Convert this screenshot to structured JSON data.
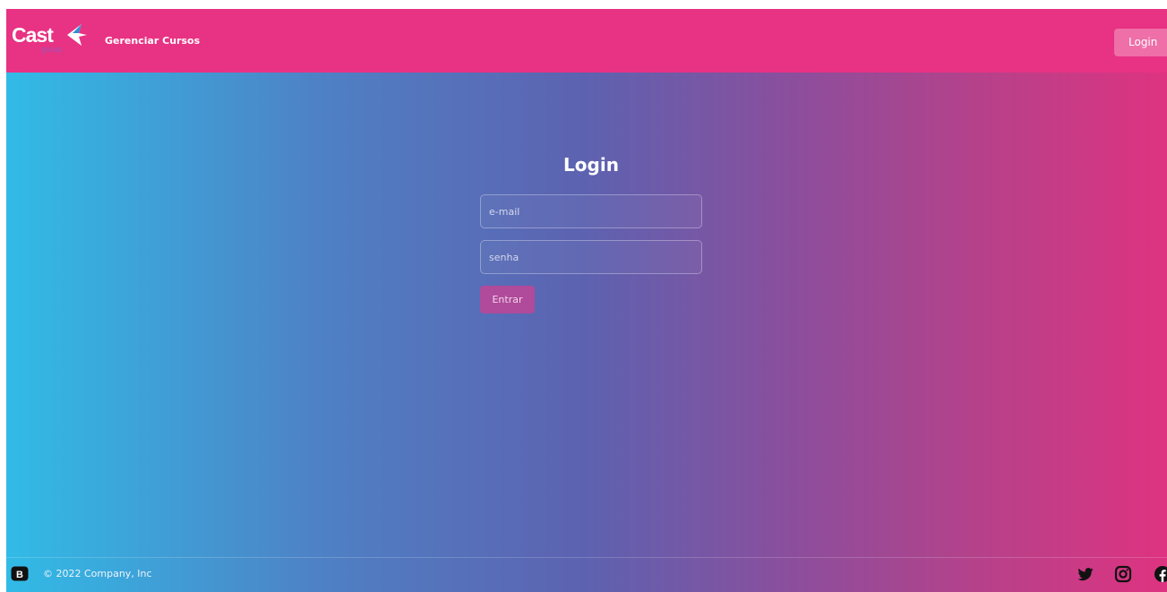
{
  "navbar": {
    "brand_name": "Cast",
    "brand_sub": "group",
    "nav_link": "Gerenciar Cursos",
    "login_button": "Login"
  },
  "login": {
    "title": "Login",
    "email_placeholder": "e-mail",
    "password_placeholder": "senha",
    "submit_label": "Entrar"
  },
  "footer": {
    "copyright": "© 2022 Company, Inc",
    "logo_letter": "B",
    "social_icons": [
      "twitter-icon",
      "instagram-icon",
      "facebook-icon"
    ]
  },
  "colors": {
    "navbar": "#e83283",
    "gradient_start": "#31bbe6",
    "gradient_mid": "#5d62b0",
    "gradient_end": "#de3380",
    "submit_button": "#b04a9a"
  }
}
